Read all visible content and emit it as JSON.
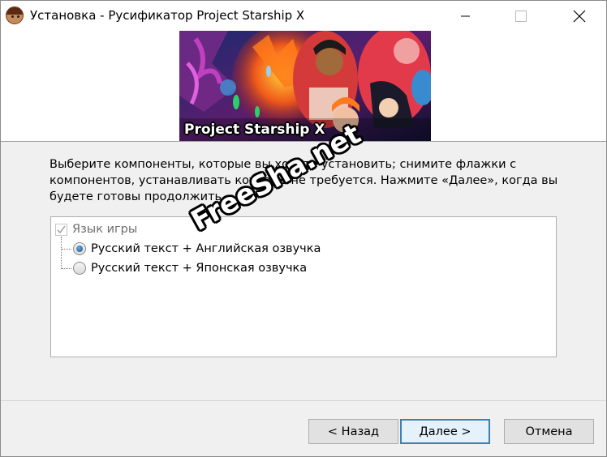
{
  "window": {
    "title": "Установка - Русификатор Project Starship X",
    "controls": [
      "minimize-icon",
      "maximize-icon",
      "close-icon"
    ]
  },
  "banner": {
    "title": "Project Starship X"
  },
  "description": "Выберите компоненты, которые вы хотите установить; снимите флажки с компонентов, устанавливать которые не требуется. Нажмите «Далее», когда вы будете готовы продолжить.",
  "components": {
    "group": {
      "label": "Язык игры",
      "checked": true,
      "disabled": true
    },
    "options": [
      {
        "label": "Русский текст + Английская озвучка",
        "selected": true
      },
      {
        "label": "Русский текст + Японская озвучка",
        "selected": false
      }
    ]
  },
  "buttons": {
    "back": "< Назад",
    "next": "Далее >",
    "cancel": "Отмена"
  },
  "watermark": "FreeSha.net",
  "colors": {
    "title_bg": "#ffffff",
    "body_bg": "#f0f0f0",
    "default_button_border": "#3c7fb1"
  }
}
